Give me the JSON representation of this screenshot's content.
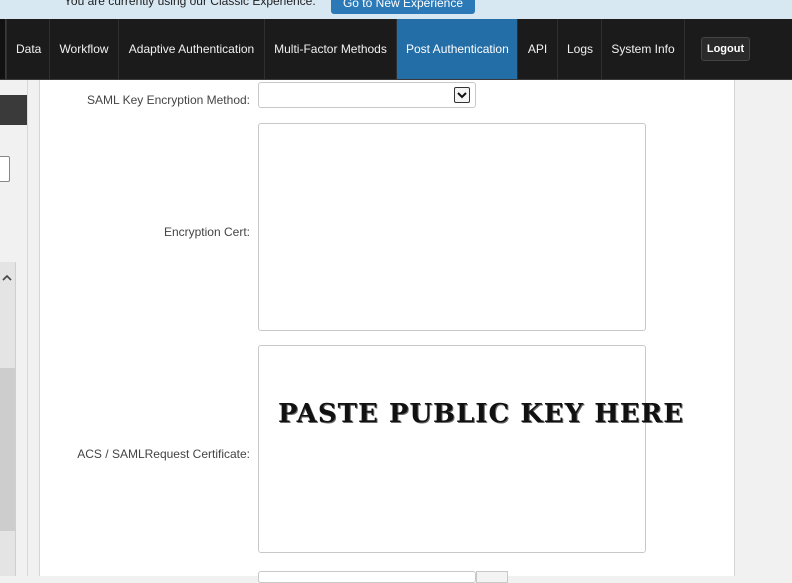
{
  "banner": {
    "text": "You are currently using our Classic Experience.",
    "button_label": "Go to New Experience"
  },
  "nav": {
    "items": [
      {
        "label": "Data",
        "active": false
      },
      {
        "label": "Workflow",
        "active": false
      },
      {
        "label": "Adaptive Authentication",
        "active": false
      },
      {
        "label": "Multi-Factor Methods",
        "active": false
      },
      {
        "label": "Post Authentication",
        "active": true
      },
      {
        "label": "API",
        "active": false
      },
      {
        "label": "Logs",
        "active": false
      },
      {
        "label": "System Info",
        "active": false
      }
    ],
    "logout_label": "Logout",
    "active_color": "#246ea8"
  },
  "form": {
    "key_encryption_label": "SAML Key Encryption Method:",
    "key_encryption_value": "",
    "encryption_cert_label": "Encryption Cert:",
    "encryption_cert_value": "",
    "acs_cert_label": "ACS / SAMLRequest Certificate:",
    "acs_cert_overlay": "PASTE PUBLIC KEY HERE"
  },
  "icons": {
    "select_arrow": "chevron-down-icon",
    "sidebar_collapse": "chevron-up-icon"
  }
}
